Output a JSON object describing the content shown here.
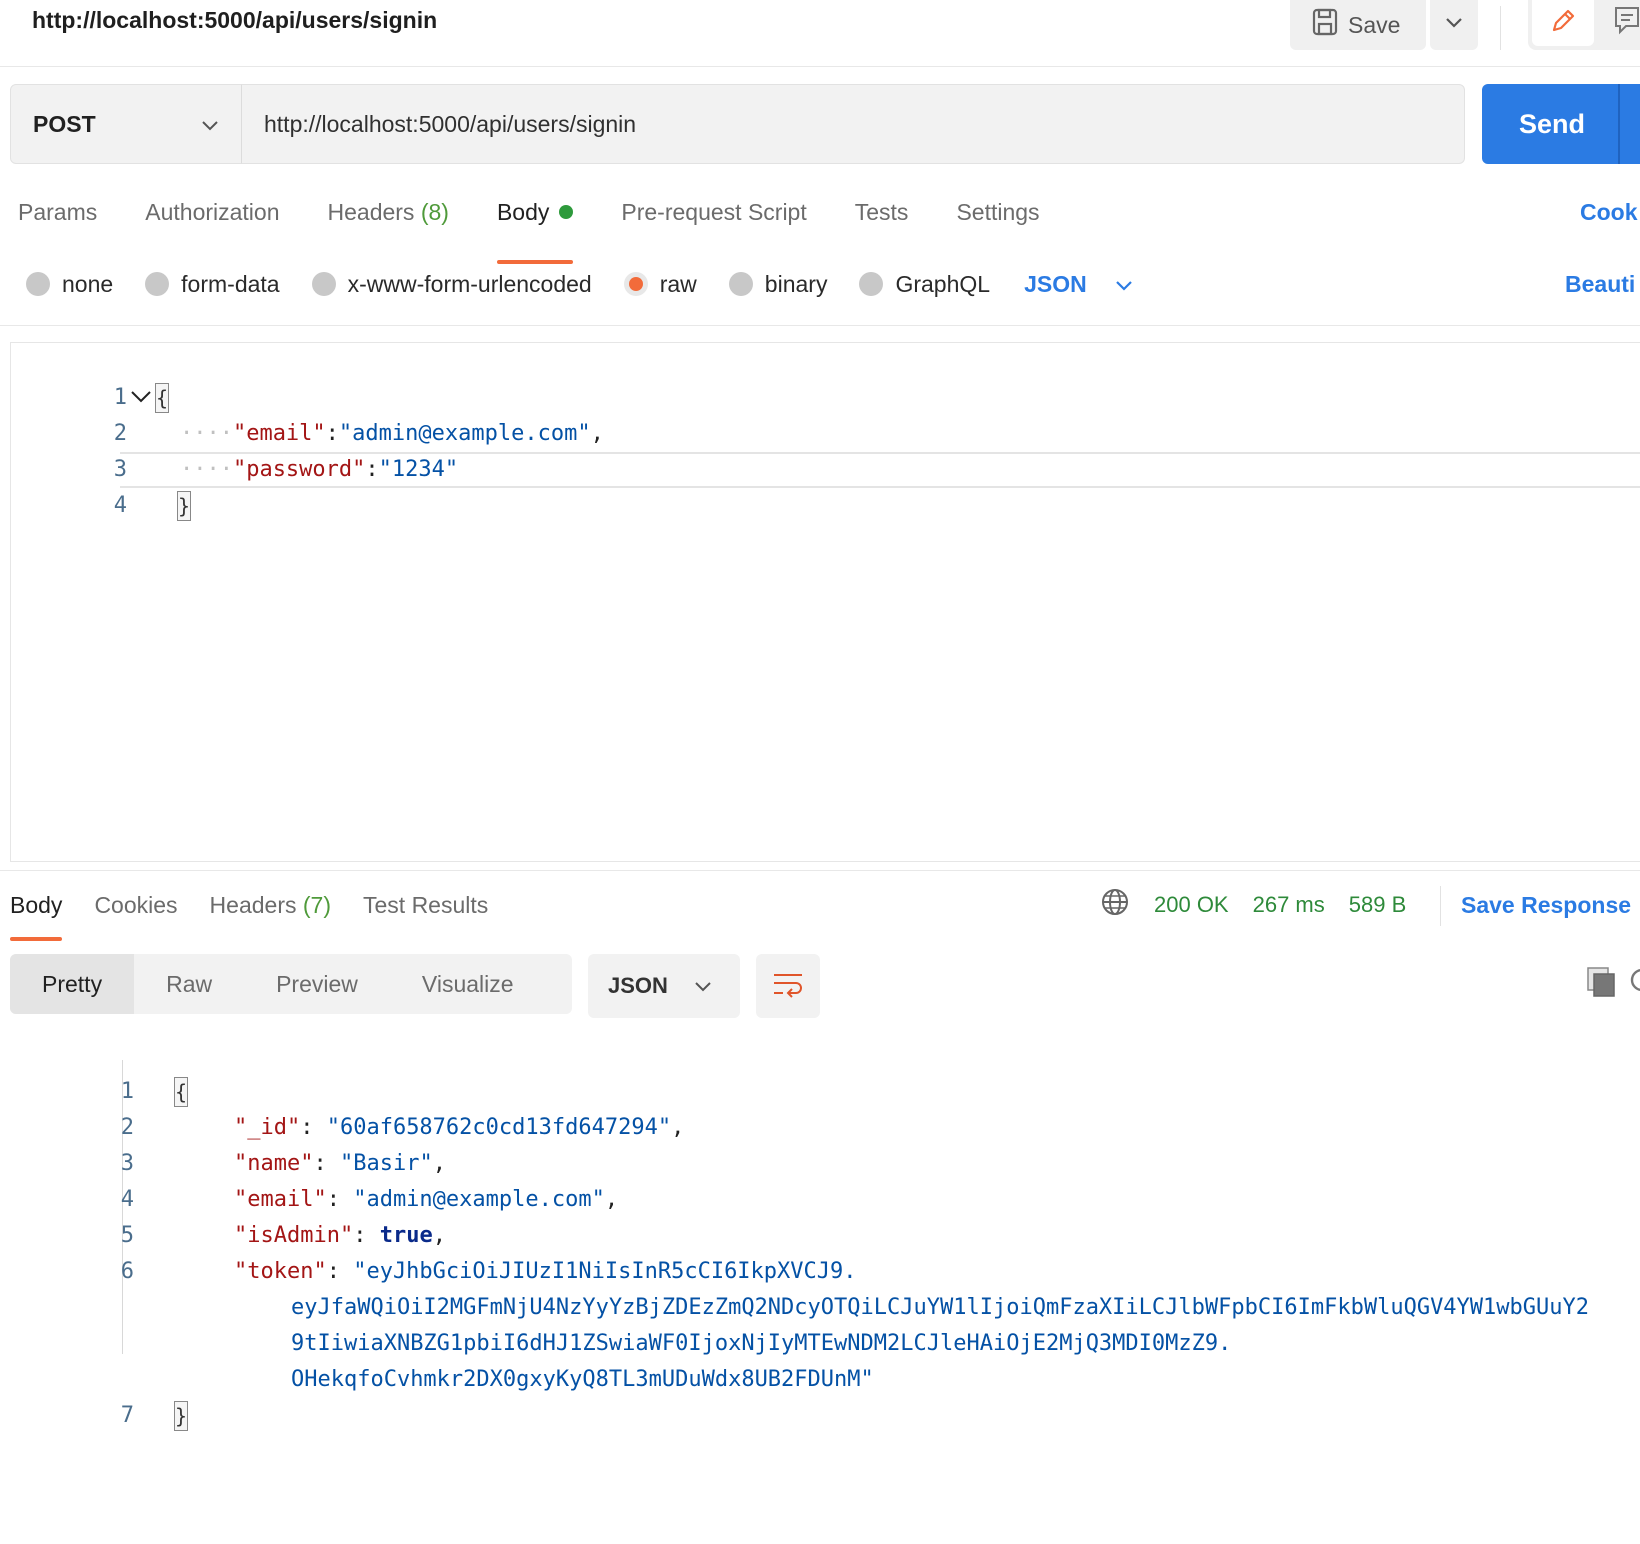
{
  "header": {
    "title": "http://localhost:5000/api/users/signin",
    "save_label": "Save",
    "icons": [
      "save-icon",
      "chevron-down-icon",
      "pencil-icon",
      "comment-icon"
    ]
  },
  "request": {
    "method": "POST",
    "url": "http://localhost:5000/api/users/signin",
    "send_label": "Send"
  },
  "request_tabs": {
    "params": "Params",
    "authorization": "Authorization",
    "headers": "Headers",
    "headers_count": "(8)",
    "body": "Body",
    "prerequest": "Pre-request Script",
    "tests": "Tests",
    "settings": "Settings",
    "cookies": "Cook"
  },
  "body_types": {
    "none": "none",
    "form_data": "form-data",
    "urlencoded": "x-www-form-urlencoded",
    "raw": "raw",
    "binary": "binary",
    "graphql": "GraphQL",
    "format": "JSON",
    "beautify": "Beauti"
  },
  "request_body": {
    "line_numbers": [
      "1",
      "2",
      "3",
      "4"
    ],
    "open_brace": "{",
    "email_key": "\"email\"",
    "email_value": "\"admin@example.com\"",
    "password_key": "\"password\"",
    "password_value": "\"1234\"",
    "close_brace": "}"
  },
  "response_tabs": {
    "body": "Body",
    "cookies": "Cookies",
    "headers": "Headers",
    "headers_count": "(7)",
    "test_results": "Test Results"
  },
  "response_status": {
    "status": "200 OK",
    "time": "267 ms",
    "size": "589 B",
    "save_response": "Save Response",
    "status_color": "#2e8a3a"
  },
  "view_modes": {
    "pretty": "Pretty",
    "raw": "Raw",
    "preview": "Preview",
    "visualize": "Visualize",
    "format": "JSON"
  },
  "response_body": {
    "line_numbers": [
      "1",
      "2",
      "3",
      "4",
      "5",
      "6",
      "7"
    ],
    "open_brace": "{",
    "id_key": "\"_id\"",
    "id_value": "\"60af658762c0cd13fd647294\"",
    "name_key": "\"name\"",
    "name_value": "\"Basir\"",
    "email_key": "\"email\"",
    "email_value": "\"admin@example.com\"",
    "isadmin_key": "\"isAdmin\"",
    "isadmin_value": "true",
    "token_key": "\"token\"",
    "token_line1": "\"eyJhbGciOiJIUzI1NiIsInR5cCI6IkpXVCJ9.",
    "token_line2": "eyJfaWQiOiI2MGFmNjU4NzYyYzBjZDEzZmQ2NDcyOTQiLCJuYW1lIjoiQmFzaXIiLCJlbWFpbCI6ImFkbWluQGV4YW1wbGUuY2",
    "token_line3": "9tIiwiaXNBZG1pbiI6dHJ1ZSwiaWF0IjoxNjIyMTEwNDM2LCJleHAiOjE2MjQ3MDI0MzZ9.",
    "token_line4": "OHekqfoCvhmkr2DX0gxyKyQ8TL3mUDuWdx8UB2FDUnM\"",
    "close_brace": "}"
  },
  "colors": {
    "accent": "#2b7be3",
    "tab_underline": "#f26b3a",
    "json_key": "#a31515",
    "json_string": "#0451a5"
  }
}
